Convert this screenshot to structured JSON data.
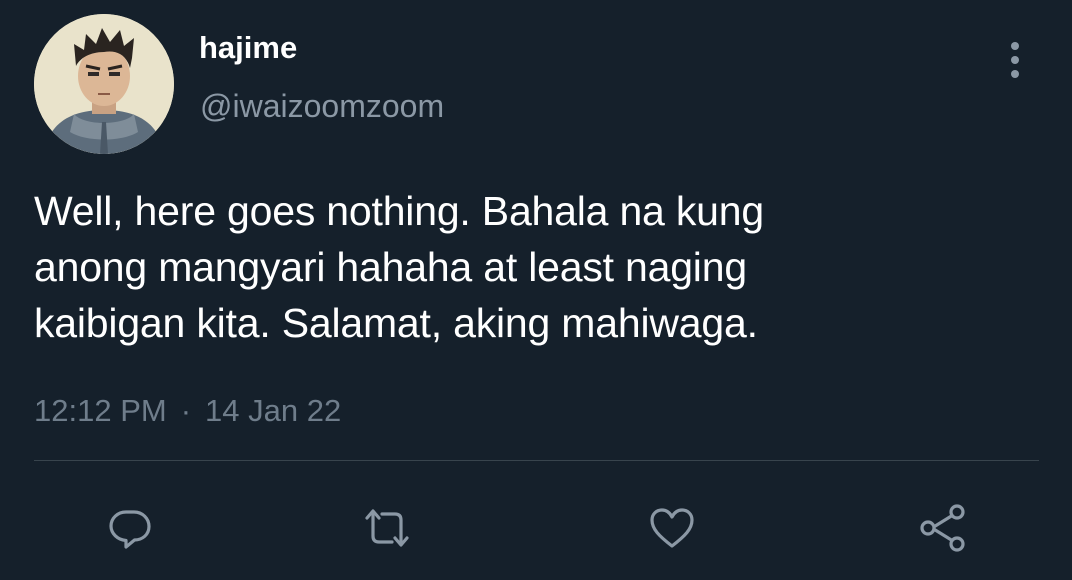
{
  "user": {
    "display_name": "hajime",
    "handle": "@iwaizoomzoom",
    "avatar_icon": "anime-avatar"
  },
  "tweet": {
    "lines": [
      "Well, here goes nothing. Bahala na kung",
      "anong mangyari hahaha at least naging",
      "kaibigan kita. Salamat, aking mahiwaga."
    ],
    "time": "12:12 PM",
    "separator": "·",
    "date": "14 Jan 22"
  },
  "actions": [
    {
      "icon": "reply-icon"
    },
    {
      "icon": "retweet-icon"
    },
    {
      "icon": "like-icon"
    },
    {
      "icon": "share-icon"
    }
  ],
  "menu": {
    "icon": "more-vertical-icon"
  },
  "colors": {
    "background": "#15202b",
    "text": "#ffffff",
    "secondary_text": "#8b98a5",
    "divider": "#38444d"
  }
}
